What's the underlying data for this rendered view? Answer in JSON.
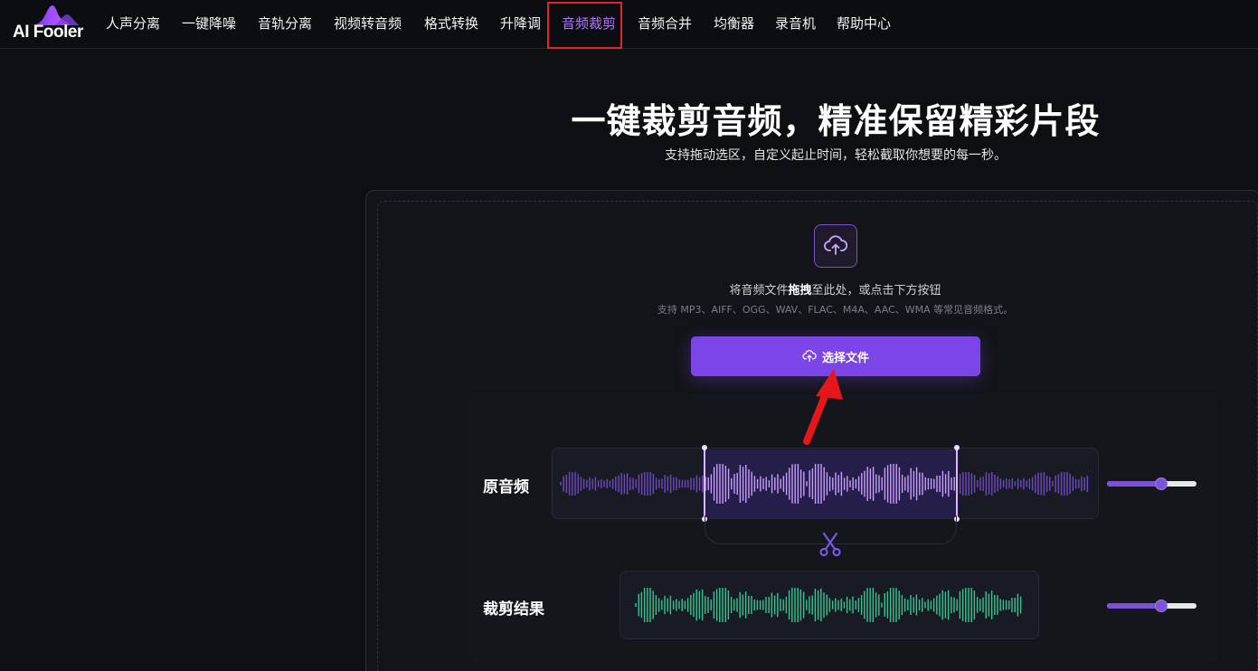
{
  "brand": {
    "name": "AI Fooler"
  },
  "nav": {
    "items": [
      {
        "label": "人声分离"
      },
      {
        "label": "一键降噪"
      },
      {
        "label": "音轨分离"
      },
      {
        "label": "视频转音频"
      },
      {
        "label": "格式转换"
      },
      {
        "label": "升降调"
      },
      {
        "label": "音频裁剪",
        "active": true
      },
      {
        "label": "音频合并"
      },
      {
        "label": "均衡器"
      },
      {
        "label": "录音机"
      },
      {
        "label": "帮助中心"
      }
    ]
  },
  "hero": {
    "title": "一键裁剪音频，精准保留精彩片段",
    "subtitle": "支持拖动选区，自定义起止时间，轻松截取你想要的每一秒。"
  },
  "upload": {
    "hint_before": "将音频文件",
    "hint_bold": "拖拽",
    "hint_after": "至此处，或点击下方按钮",
    "formats": "支持 MP3、AIFF、OGG、WAV、FLAC、M4A、AAC、WMA 等常见音频格式。",
    "button_label": "选择文件"
  },
  "demo": {
    "original_label": "原音频",
    "result_label": "裁剪结果",
    "original_volume_percent": 61,
    "result_volume_percent": 61
  },
  "colors": {
    "accent": "#7b45e8",
    "nav_active": "#b17cf5",
    "highlight_box": "#e0262b",
    "wave_original": "#8b5cf6",
    "wave_result": "#34d399"
  },
  "icons": {
    "upload": "cloud-upload-icon",
    "scissors": "scissors-icon",
    "arrow": "red-arrow-annotation"
  }
}
